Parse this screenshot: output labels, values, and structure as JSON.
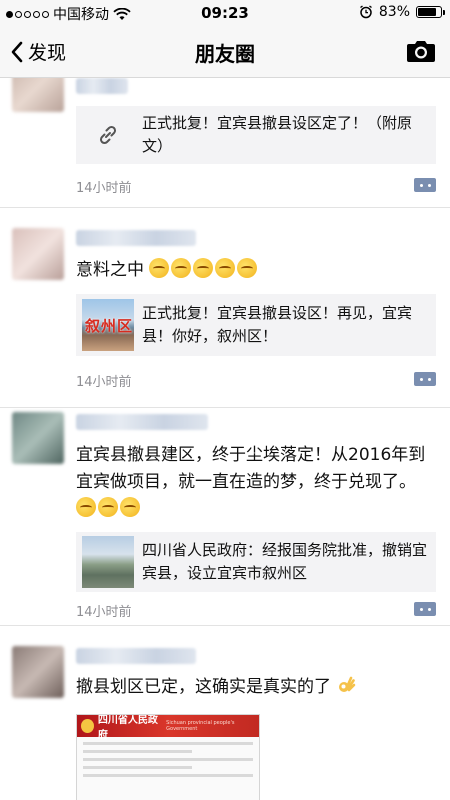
{
  "status_bar": {
    "carrier": "中国移动",
    "time": "09:23",
    "battery_text": "83%",
    "battery_level": 0.83,
    "signal_filled": 1,
    "signal_total": 5
  },
  "nav": {
    "back_label": "发现",
    "title": "朋友圈",
    "camera_icon": "camera-icon"
  },
  "posts": [
    {
      "link_text": "正式批复！宜宾县撤县设区定了！（附原文）",
      "link_icon": "link-icon",
      "time": "14小时前"
    },
    {
      "text": "意料之中",
      "emoji_count": 5,
      "link_text": "正式批复！宜宾县撤县设区！再见，宜宾县！你好，叙州区！",
      "thumb_label": "叙州区",
      "time": "14小时前"
    },
    {
      "text": "宜宾县撤县建区，终于尘埃落定！从2016年到宜宾做项目，就一直在造的梦，终于兑现了。",
      "emoji_count": 3,
      "link_text": "四川省人民政府：经报国务院批准，撤销宜宾县，设立宜宾市叙州区",
      "time": "14小时前"
    },
    {
      "text": "撤县划区已定，这确实是真实的了",
      "image_title": "四川省人民政府",
      "image_subtitle": "Sichuan provincial people's Government"
    }
  ],
  "colors": {
    "nav_bg": "#f7f7f7",
    "card_bg": "#f3f3f5",
    "meta_gray": "#8e8e93",
    "comment_blue": "#7a8eb0",
    "gov_red": "#c22a22"
  }
}
